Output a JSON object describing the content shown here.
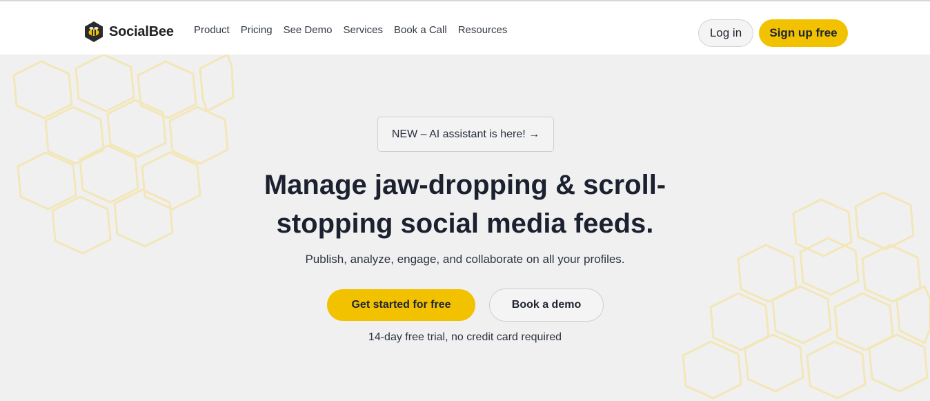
{
  "brand": {
    "name": "SocialBee",
    "accent_color": "#f2c200",
    "logo_icon": "bee-hexagon-icon"
  },
  "nav": {
    "items": [
      {
        "label": "Product"
      },
      {
        "label": "Pricing"
      },
      {
        "label": "See Demo"
      },
      {
        "label": "Services"
      },
      {
        "label": "Book a Call"
      },
      {
        "label": "Resources"
      }
    ],
    "login_label": "Log in",
    "signup_label": "Sign up free"
  },
  "hero": {
    "badge_text": "NEW – AI assistant is here! →",
    "headline_line1": "Manage jaw-dropping & scroll-",
    "headline_line2": "stopping social media feeds.",
    "subtitle": "Publish, analyze, engage, and collaborate on all your profiles.",
    "primary_cta": "Get started for free",
    "secondary_cta": "Book a demo",
    "trial_note": "14-day free trial, no credit card required"
  },
  "colors": {
    "hero_background": "#f0f0f0",
    "honeycomb_outline": "#f3e6b8",
    "heading_text": "#1c2130"
  }
}
